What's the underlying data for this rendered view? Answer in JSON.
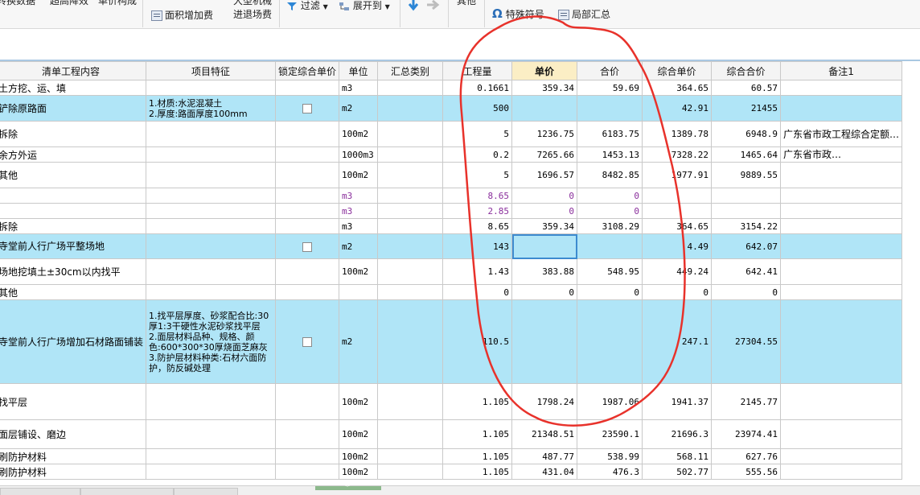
{
  "toolbar": {
    "convert_data": "转换数据",
    "raise_height": "超高降效",
    "unit_price_composition": "单价构成",
    "area_increase_fee": "面积增加费",
    "large_machinery_line1": "大型机械",
    "large_machinery_line2": "进退场费",
    "filter": "过滤",
    "expand_to": "展开到",
    "other": "其他",
    "special_symbol": "特殊符号",
    "partial_summary": "局部汇总"
  },
  "table": {
    "headers": [
      "清单工程内容",
      "项目特征",
      "锁定综合单价",
      "单位",
      "汇总类别",
      "工程量",
      "单价",
      "合价",
      "综合单价",
      "综合合价",
      "备注1"
    ],
    "rows": [
      {
        "name": "土方挖、运、填",
        "feature": "",
        "lock": false,
        "unit": "m3",
        "category": "",
        "qty": "0.1661",
        "price": "359.34",
        "total": "59.69",
        "comp_price": "364.65",
        "comp_total": "60.57",
        "note": ""
      },
      {
        "name": "铲除原路面",
        "feature": "1.材质:水泥混凝土\n2.厚度:路面厚度100mm",
        "lock": true,
        "unit": "m2",
        "category": "",
        "qty": "500",
        "price": "",
        "total": "",
        "comp_price": "42.91",
        "comp_total": "21455",
        "note": ""
      },
      {
        "name": "拆除",
        "feature": "",
        "lock": false,
        "unit": "100m2",
        "category": "",
        "qty": "5",
        "price": "1236.75",
        "total": "6183.75",
        "comp_price": "1389.78",
        "comp_total": "6948.9",
        "note": "广东省市政工程综合定额…"
      },
      {
        "name": "余方外运",
        "feature": "",
        "lock": false,
        "unit": "1000m3",
        "category": "",
        "qty": "0.2",
        "price": "7265.66",
        "total": "1453.13",
        "comp_price": "7328.22",
        "comp_total": "1465.64",
        "note": "广东省市政…"
      },
      {
        "name": "其他",
        "feature": "",
        "lock": false,
        "unit": "100m2",
        "category": "",
        "qty": "5",
        "price": "1696.57",
        "total": "8482.85",
        "comp_price": "1977.91",
        "comp_total": "9889.55",
        "note": ""
      },
      {
        "name": "",
        "feature": "",
        "lock": false,
        "unit": "m3",
        "category": "",
        "qty": "8.65",
        "price": "0",
        "total": "0",
        "comp_price": "",
        "comp_total": "",
        "note": ""
      },
      {
        "name": "",
        "feature": "",
        "lock": false,
        "unit": "m3",
        "category": "",
        "qty": "2.85",
        "price": "0",
        "total": "0",
        "comp_price": "",
        "comp_total": "",
        "note": ""
      },
      {
        "name": "拆除",
        "feature": "",
        "lock": false,
        "unit": "m3",
        "category": "",
        "qty": "8.65",
        "price": "359.34",
        "total": "3108.29",
        "comp_price": "364.65",
        "comp_total": "3154.22",
        "note": ""
      },
      {
        "name": "寺堂前人行广场平整场地",
        "feature": "",
        "lock": true,
        "unit": "m2",
        "category": "",
        "qty": "143",
        "price": "",
        "total": "",
        "comp_price": "4.49",
        "comp_total": "642.07",
        "note": ""
      },
      {
        "name": "场地挖填土±30cm以内找平",
        "feature": "",
        "lock": false,
        "unit": "100m2",
        "category": "",
        "qty": "1.43",
        "price": "383.88",
        "total": "548.95",
        "comp_price": "449.24",
        "comp_total": "642.41",
        "note": ""
      },
      {
        "name": "其他",
        "feature": "",
        "lock": false,
        "unit": "",
        "category": "",
        "qty": "0",
        "price": "0",
        "total": "0",
        "comp_price": "0",
        "comp_total": "0",
        "note": ""
      },
      {
        "name": "寺堂前人行广场增加石材路面铺装",
        "feature": "1.找平层厚度、砂浆配合比:30厚1:3干硬性水泥砂浆找平层\n2.面层材料品种、规格、颜色:600*300*30厚烧面芝麻灰\n3.防护层材料种类:石材六面防护，防反碱处理",
        "lock": true,
        "unit": "m2",
        "category": "",
        "qty": "110.5",
        "price": "",
        "total": "",
        "comp_price": "247.1",
        "comp_total": "27304.55",
        "note": ""
      },
      {
        "name": "找平层",
        "feature": "",
        "lock": false,
        "unit": "100m2",
        "category": "",
        "qty": "1.105",
        "price": "1798.24",
        "total": "1987.06",
        "comp_price": "1941.37",
        "comp_total": "2145.77",
        "note": ""
      },
      {
        "name": "面层铺设、磨边",
        "feature": "",
        "lock": false,
        "unit": "100m2",
        "category": "",
        "qty": "1.105",
        "price": "21348.51",
        "total": "23590.1",
        "comp_price": "21696.3",
        "comp_total": "23974.41",
        "note": ""
      },
      {
        "name": "刷防护材料",
        "feature": "",
        "lock": false,
        "unit": "100m2",
        "category": "",
        "qty": "1.105",
        "price": "487.77",
        "total": "538.99",
        "comp_price": "568.11",
        "comp_total": "627.76",
        "note": ""
      },
      {
        "name": "刷防护材料",
        "feature": "",
        "lock": false,
        "unit": "100m2",
        "category": "",
        "qty": "1.105",
        "price": "431.04",
        "total": "476.3",
        "comp_price": "502.77",
        "comp_total": "555.56",
        "note": ""
      }
    ]
  },
  "colors": {
    "highlight_row": "#b0e5f7",
    "active_header": "#fbeec5",
    "annotation": "#e8322b",
    "purple_value": "#8a2f9c"
  }
}
